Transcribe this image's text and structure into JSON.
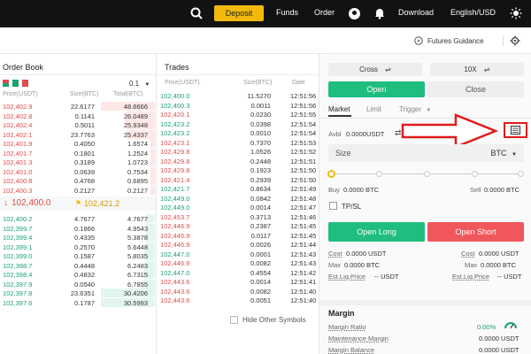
{
  "topbar": {
    "deposit": "Deposit",
    "funds": "Funds",
    "order": "Order",
    "download": "Download",
    "locale": "English/USD",
    "icons": [
      "search-icon",
      "user-icon",
      "bell-icon",
      "theme-icon"
    ]
  },
  "subbar": {
    "futures_guidance": "Futures Guidance"
  },
  "orderbook": {
    "title": "Order Book",
    "precision": "0.1",
    "headers": [
      "Price(USDT)",
      "Size(BTC)",
      "Total(BTC)"
    ],
    "asks": [
      {
        "p": "102,402.9",
        "s": "22.6177",
        "t": "48.6666"
      },
      {
        "p": "102,402.8",
        "s": "0.1141",
        "t": "26.0489"
      },
      {
        "p": "102,402.4",
        "s": "0.5011",
        "t": "25.9348"
      },
      {
        "p": "102,402.1",
        "s": "23.7763",
        "t": "25.4337"
      },
      {
        "p": "102,401.9",
        "s": "0.4050",
        "t": "1.6574"
      },
      {
        "p": "102,401.7",
        "s": "0.1801",
        "t": "1.2524"
      },
      {
        "p": "102,401.3",
        "s": "0.3189",
        "t": "1.0723"
      },
      {
        "p": "102,401.0",
        "s": "0.0639",
        "t": "0.7534"
      },
      {
        "p": "102,400.8",
        "s": "0.4768",
        "t": "0.6895"
      },
      {
        "p": "102,400.3",
        "s": "0.2127",
        "t": "0.2127"
      }
    ],
    "last_price": "102,400.0",
    "mark_price": "102,421.2",
    "bids": [
      {
        "p": "102,400.2",
        "s": "4.7677",
        "t": "4.7677"
      },
      {
        "p": "102,399.7",
        "s": "0.1866",
        "t": "4.9543"
      },
      {
        "p": "102,399.4",
        "s": "0.4335",
        "t": "5.3878"
      },
      {
        "p": "102,399.1",
        "s": "0.2570",
        "t": "5.6448"
      },
      {
        "p": "102,399.0",
        "s": "0.1587",
        "t": "5.8035"
      },
      {
        "p": "102,398.7",
        "s": "0.4448",
        "t": "6.2483"
      },
      {
        "p": "102,398.4",
        "s": "0.4832",
        "t": "6.7315"
      },
      {
        "p": "102,397.9",
        "s": "0.0540",
        "t": "6.7855"
      },
      {
        "p": "102,397.8",
        "s": "23.6351",
        "t": "30.4206"
      },
      {
        "p": "102,397.6",
        "s": "0.1787",
        "t": "30.5993"
      }
    ]
  },
  "trades": {
    "title": "Trades",
    "headers": [
      "Price(USDT)",
      "Size(BTC)",
      "Date"
    ],
    "rows": [
      {
        "p": "102,400.0",
        "s": "11.5270",
        "t": "12:51:56",
        "d": "up"
      },
      {
        "p": "102,400.3",
        "s": "0.0011",
        "t": "12:51:56",
        "d": "up"
      },
      {
        "p": "102,420.1",
        "s": "0.0230",
        "t": "12:51:55",
        "d": "down"
      },
      {
        "p": "102,423.2",
        "s": "0.0398",
        "t": "12:51:54",
        "d": "up"
      },
      {
        "p": "102,423.2",
        "s": "0.0010",
        "t": "12:51:54",
        "d": "up"
      },
      {
        "p": "102,423.1",
        "s": "0.7370",
        "t": "12:51:53",
        "d": "down"
      },
      {
        "p": "102,429.8",
        "s": "1.0526",
        "t": "12:51:52",
        "d": "down"
      },
      {
        "p": "102,429.8",
        "s": "0.2448",
        "t": "12:51:51",
        "d": "down"
      },
      {
        "p": "102,429.8",
        "s": "0.1923",
        "t": "12:51:50",
        "d": "down"
      },
      {
        "p": "102,421.4",
        "s": "0.2939",
        "t": "12:51:50",
        "d": "down"
      },
      {
        "p": "102,421.7",
        "s": "0.8634",
        "t": "12:51:49",
        "d": "up"
      },
      {
        "p": "102,449.0",
        "s": "0.0842",
        "t": "12:51:48",
        "d": "up"
      },
      {
        "p": "102,449.0",
        "s": "0.0014",
        "t": "12:51:47",
        "d": "up"
      },
      {
        "p": "102,453.7",
        "s": "0.3713",
        "t": "12:51:46",
        "d": "down"
      },
      {
        "p": "102,446.9",
        "s": "0.2387",
        "t": "12:51:45",
        "d": "down"
      },
      {
        "p": "102,446.9",
        "s": "0.0117",
        "t": "12:51:45",
        "d": "down"
      },
      {
        "p": "102,446.9",
        "s": "0.0026",
        "t": "12:51:44",
        "d": "down"
      },
      {
        "p": "102,447.0",
        "s": "0.0001",
        "t": "12:51:43",
        "d": "up"
      },
      {
        "p": "102,446.9",
        "s": "0.0082",
        "t": "12:51:43",
        "d": "down"
      },
      {
        "p": "102,447.0",
        "s": "0.4554",
        "t": "12:51:42",
        "d": "up"
      },
      {
        "p": "102,443.6",
        "s": "0.0014",
        "t": "12:51:41",
        "d": "down"
      },
      {
        "p": "102,443.6",
        "s": "0.0082",
        "t": "12:51:40",
        "d": "down"
      },
      {
        "p": "102,443.6",
        "s": "0.0051",
        "t": "12:51:40",
        "d": "down"
      }
    ],
    "hide_other": "Hide Other Symbols"
  },
  "order_panel": {
    "margin_mode": "Cross",
    "leverage": "10X",
    "open": "Open",
    "close": "Close",
    "tabs": [
      "Market",
      "Limit",
      "Trigger"
    ],
    "avbl_label": "Avbl",
    "avbl_value": "0.0000USDT",
    "size_label": "Size",
    "size_unit": "BTC",
    "buy_label": "Buy",
    "buy_value": "0.0000 BTC",
    "sell_label": "Sell",
    "sell_value": "0.0000 BTC",
    "tpsl": "TP/SL",
    "open_long": "Open Long",
    "open_short": "Open Short",
    "cost_label": "Cost",
    "cost_value": "0.0000 USDT",
    "max_label": "Max",
    "max_value": "0.0000 BTC",
    "liq_label": "Est.Liq.Price",
    "liq_value": "-- USDT",
    "colors": {
      "long": "#1fbd7e",
      "short": "#f0575c",
      "brand": "#f0b90b",
      "arrow": "#e01b1b"
    }
  },
  "margin": {
    "title": "Margin",
    "ratio_label": "Margin Ratio",
    "ratio_value": "0.00%",
    "maint_label": "Maintenance Margin",
    "maint_value": "0.0000 USDT",
    "bal_label": "Margin Balance",
    "bal_value": "0.0000 USDT"
  }
}
